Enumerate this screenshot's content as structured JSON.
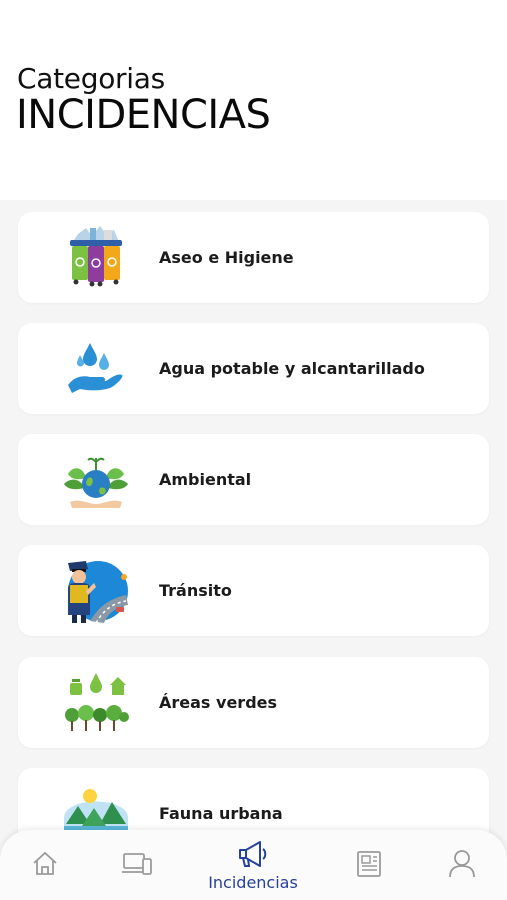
{
  "header": {
    "subtitle": "Categorias",
    "title": "INCIDENCIAS"
  },
  "categories": [
    {
      "label": "Aseo e Higiene",
      "icon": "recycling-bins-icon"
    },
    {
      "label": "Agua potable y alcantarillado",
      "icon": "water-hand-icon"
    },
    {
      "label": "Ambiental",
      "icon": "earth-plant-icon"
    },
    {
      "label": "Tránsito",
      "icon": "traffic-officer-icon"
    },
    {
      "label": "Áreas verdes",
      "icon": "green-trees-icon"
    },
    {
      "label": "Fauna urbana",
      "icon": "forest-landscape-icon"
    }
  ],
  "tabbar": {
    "active_label": "Incidencias",
    "tabs": [
      "home-icon",
      "devices-icon",
      "megaphone-icon",
      "newspaper-icon",
      "user-icon"
    ],
    "active_color": "#25419a",
    "inactive_color": "#9a9a9a"
  }
}
